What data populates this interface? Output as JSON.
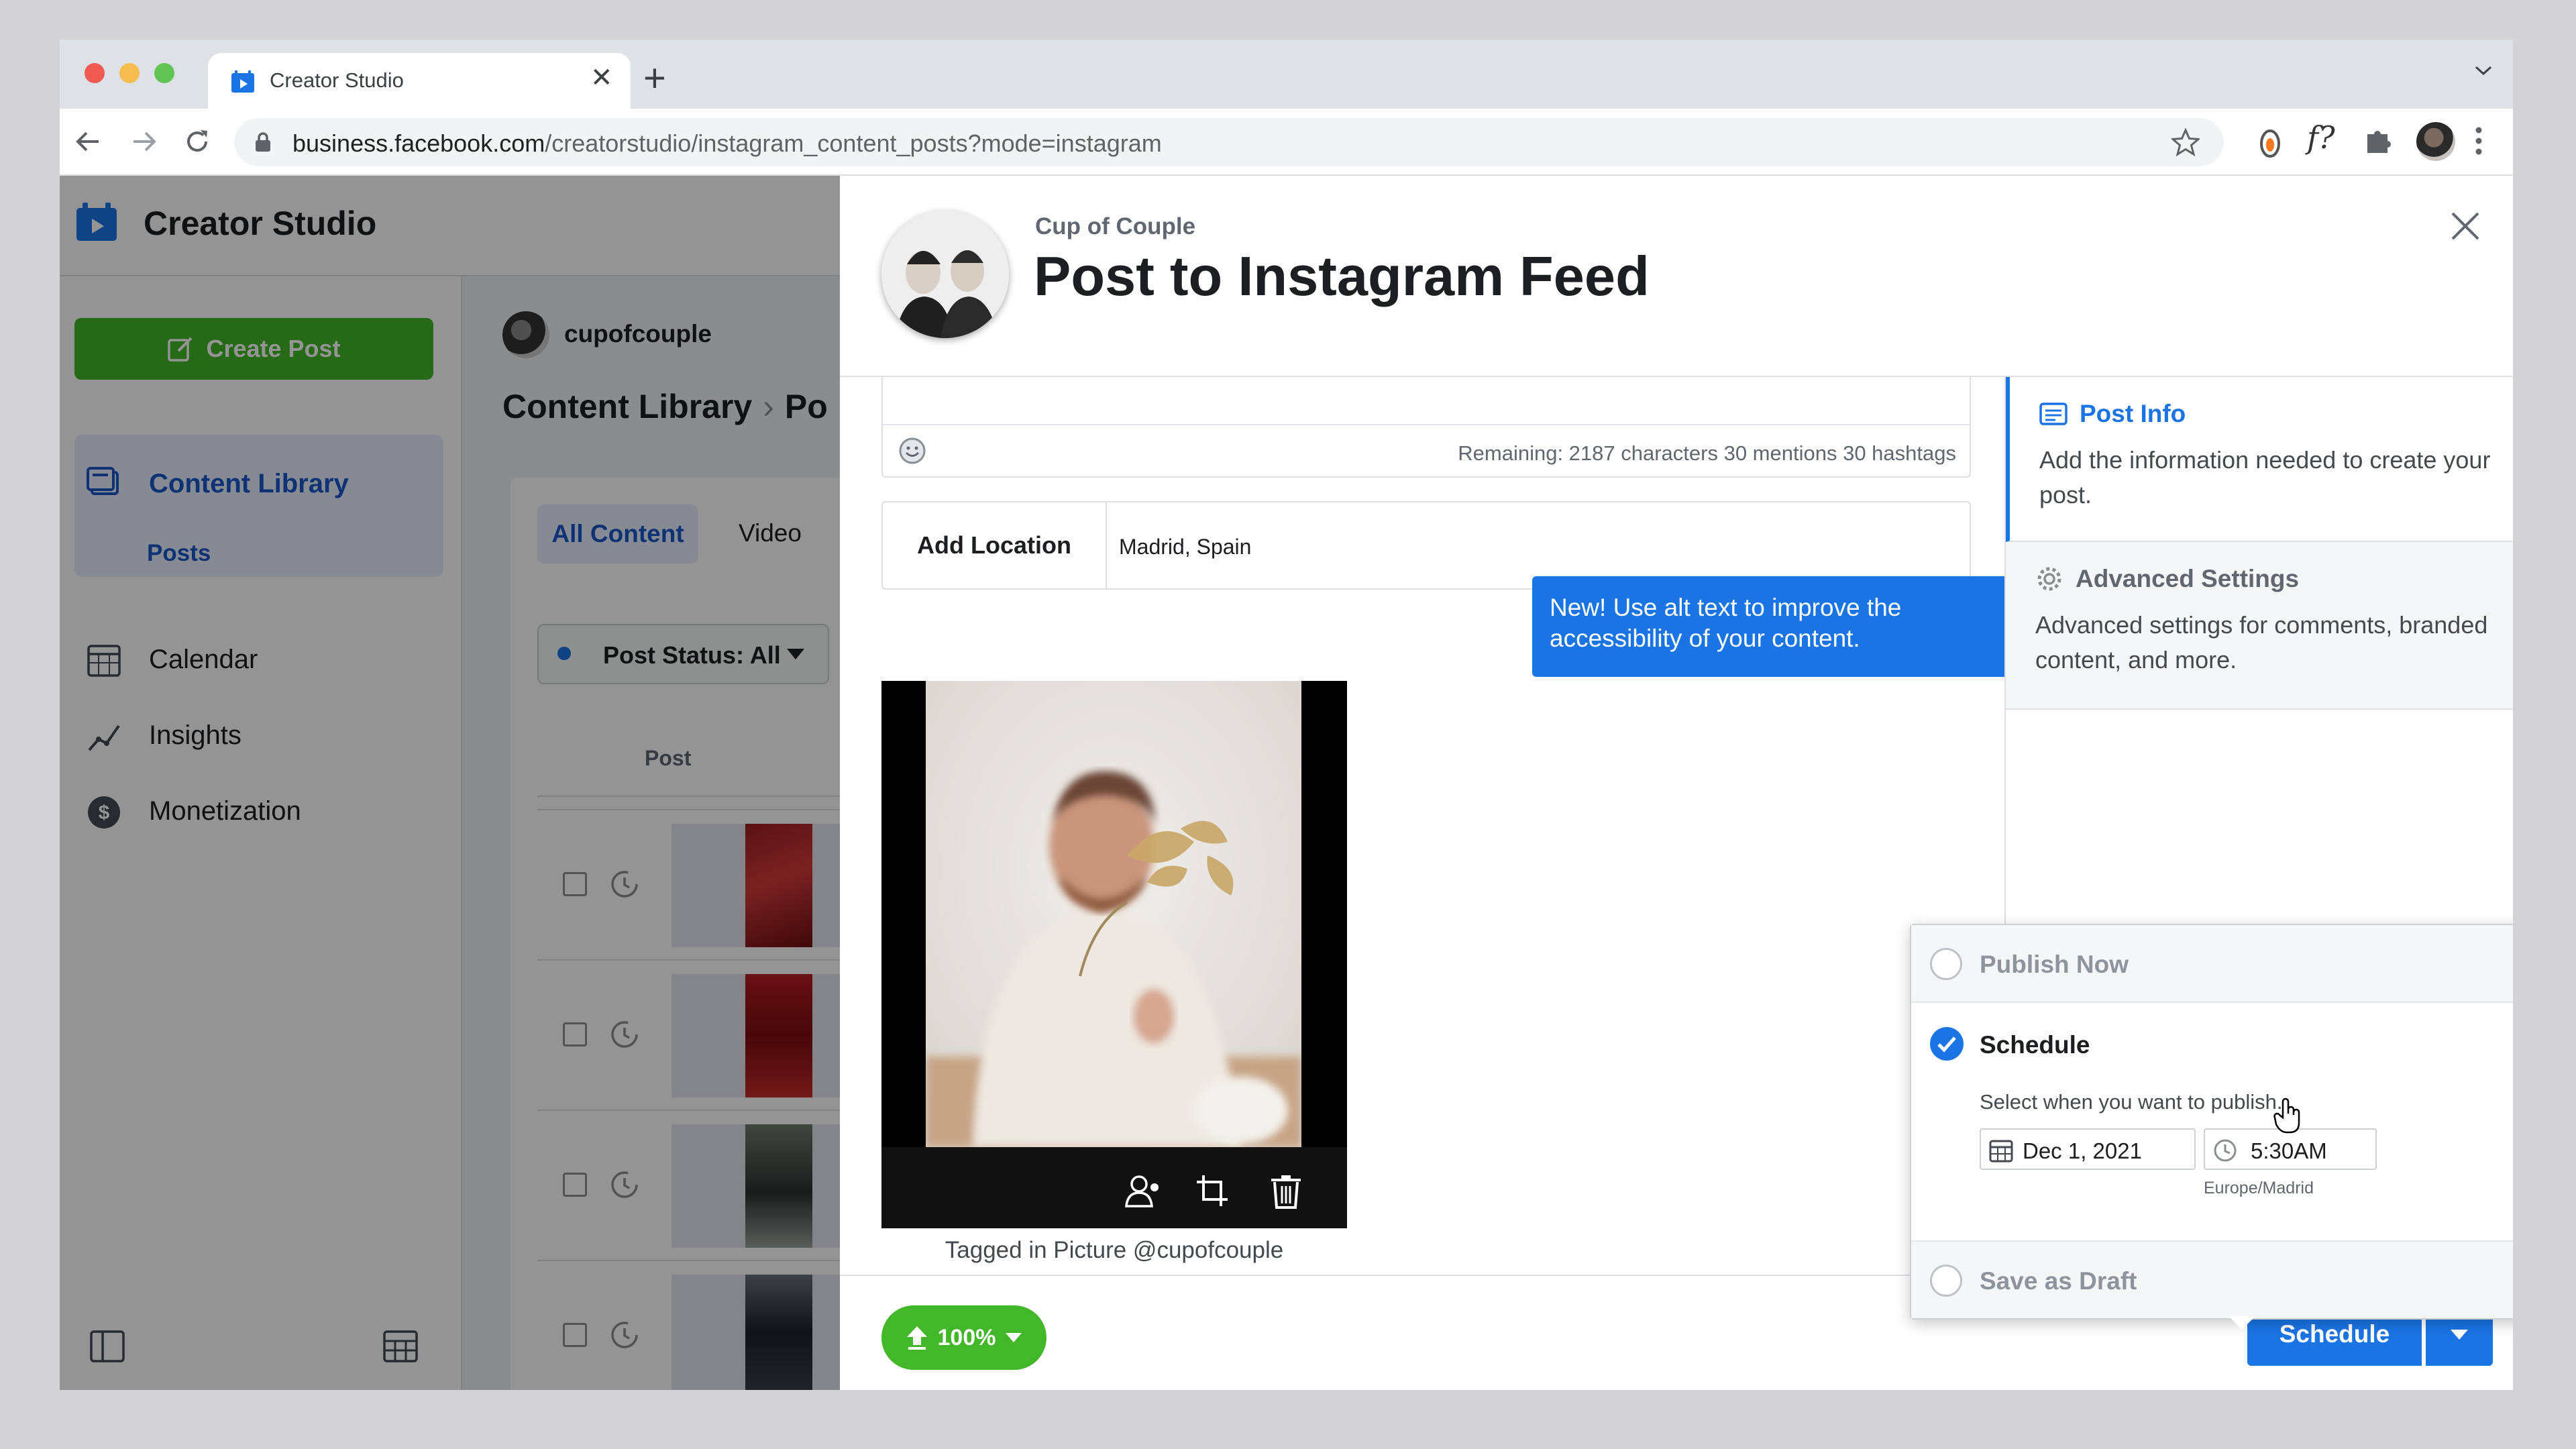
{
  "browser": {
    "tab_title": "Creator Studio",
    "url_domain": "business.facebook.com",
    "url_path": "/creatorstudio/instagram_content_posts?mode=instagram",
    "traffic_lights": [
      "#ee5a52",
      "#f5bd4f",
      "#61c454"
    ]
  },
  "app": {
    "title": "Creator Studio",
    "create_post_label": "Create Post",
    "nav": {
      "content_library": "Content Library",
      "posts": "Posts",
      "calendar": "Calendar",
      "insights": "Insights",
      "monetization": "Monetization"
    },
    "account_name": "cupofcouple",
    "breadcrumb_root": "Content Library",
    "breadcrumb_current": "Po",
    "tabs": {
      "all": "All Content",
      "video": "Video"
    },
    "filter_label": "Post Status: All",
    "column_post": "Post"
  },
  "modal": {
    "account": "Cup of Couple",
    "title": "Post to Instagram Feed",
    "remaining": "Remaining: 2187 characters 30 mentions 30 hashtags",
    "location_label": "Add Location",
    "location_value": "Madrid, Spain",
    "tooltip": "New! Use alt text to improve the accessibility of your content.",
    "tagged": "Tagged in Picture @cupofcouple",
    "side_panel": {
      "post_info_title": "Post Info",
      "post_info_desc": "Add the information needed to create your post.",
      "advanced_title": "Advanced Settings",
      "advanced_desc": "Advanced settings for comments, branded content, and more."
    },
    "publish": {
      "publish_now": "Publish Now",
      "schedule": "Schedule",
      "schedule_help": "Select when you want to publish.",
      "date": "Dec 1, 2021",
      "time": "5:30AM",
      "timezone": "Europe/Madrid",
      "save_draft": "Save as Draft",
      "selected": "schedule"
    },
    "footer": {
      "upload_progress": "100%",
      "schedule_button": "Schedule"
    }
  },
  "colors": {
    "accent": "#1b74e4",
    "success": "#42b72a"
  }
}
